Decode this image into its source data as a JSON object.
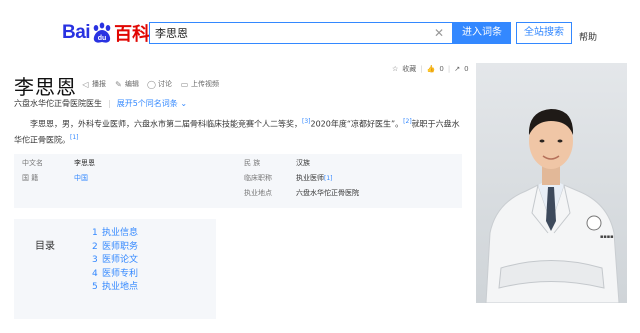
{
  "header": {
    "logo_bai": "Bai",
    "logo_du": "du",
    "logo_baike": "百科",
    "search_value": "李思恩",
    "enter_button": "进入词条",
    "site_search_button": "全站搜索",
    "help_link": "帮助"
  },
  "entry": {
    "title": "李思恩",
    "actions": [
      {
        "icon": "speaker-icon",
        "label": "播报"
      },
      {
        "icon": "edit-icon",
        "label": "编辑"
      },
      {
        "icon": "comment-icon",
        "label": "讨论"
      },
      {
        "icon": "video-upload-icon",
        "label": "上传视频"
      }
    ],
    "tools": {
      "favorite_label": "收藏",
      "like_count": "0",
      "share_count": "0"
    },
    "subtitle": "六盘水华佗正骨医院医生",
    "expand_link": "展开5个同名词条",
    "summary_part1": "李思恩，男，外科专业医师，六盘水市第二届骨科临床技能竞赛个人二等奖，",
    "summary_ref1": "[3]",
    "summary_part2": "2020年度“凉都好医生”。",
    "summary_ref2": "[2]",
    "summary_part3": "就职于六盘水华佗正骨医院。",
    "summary_ref3": "[1]"
  },
  "infobox": {
    "rows": [
      {
        "label": "中文名",
        "value": "李思恩"
      },
      {
        "label": "国    籍",
        "value": "中国"
      },
      {
        "label": "民    族",
        "value": "汉族"
      },
      {
        "label": "临床职称",
        "value": "执业医师",
        "ref": "[1]"
      },
      {
        "label": "执业地点",
        "value": "六盘水华佗正骨医院"
      }
    ]
  },
  "toc": {
    "title": "目录",
    "items": [
      {
        "num": "1",
        "label": "执业信息"
      },
      {
        "num": "2",
        "label": "医师职务"
      },
      {
        "num": "3",
        "label": "医师论文"
      },
      {
        "num": "4",
        "label": "医师专利"
      },
      {
        "num": "5",
        "label": "执业地点"
      }
    ]
  },
  "colors": {
    "accent": "#3388ff",
    "logo_blue": "#2932e1",
    "logo_red": "#e10602"
  }
}
